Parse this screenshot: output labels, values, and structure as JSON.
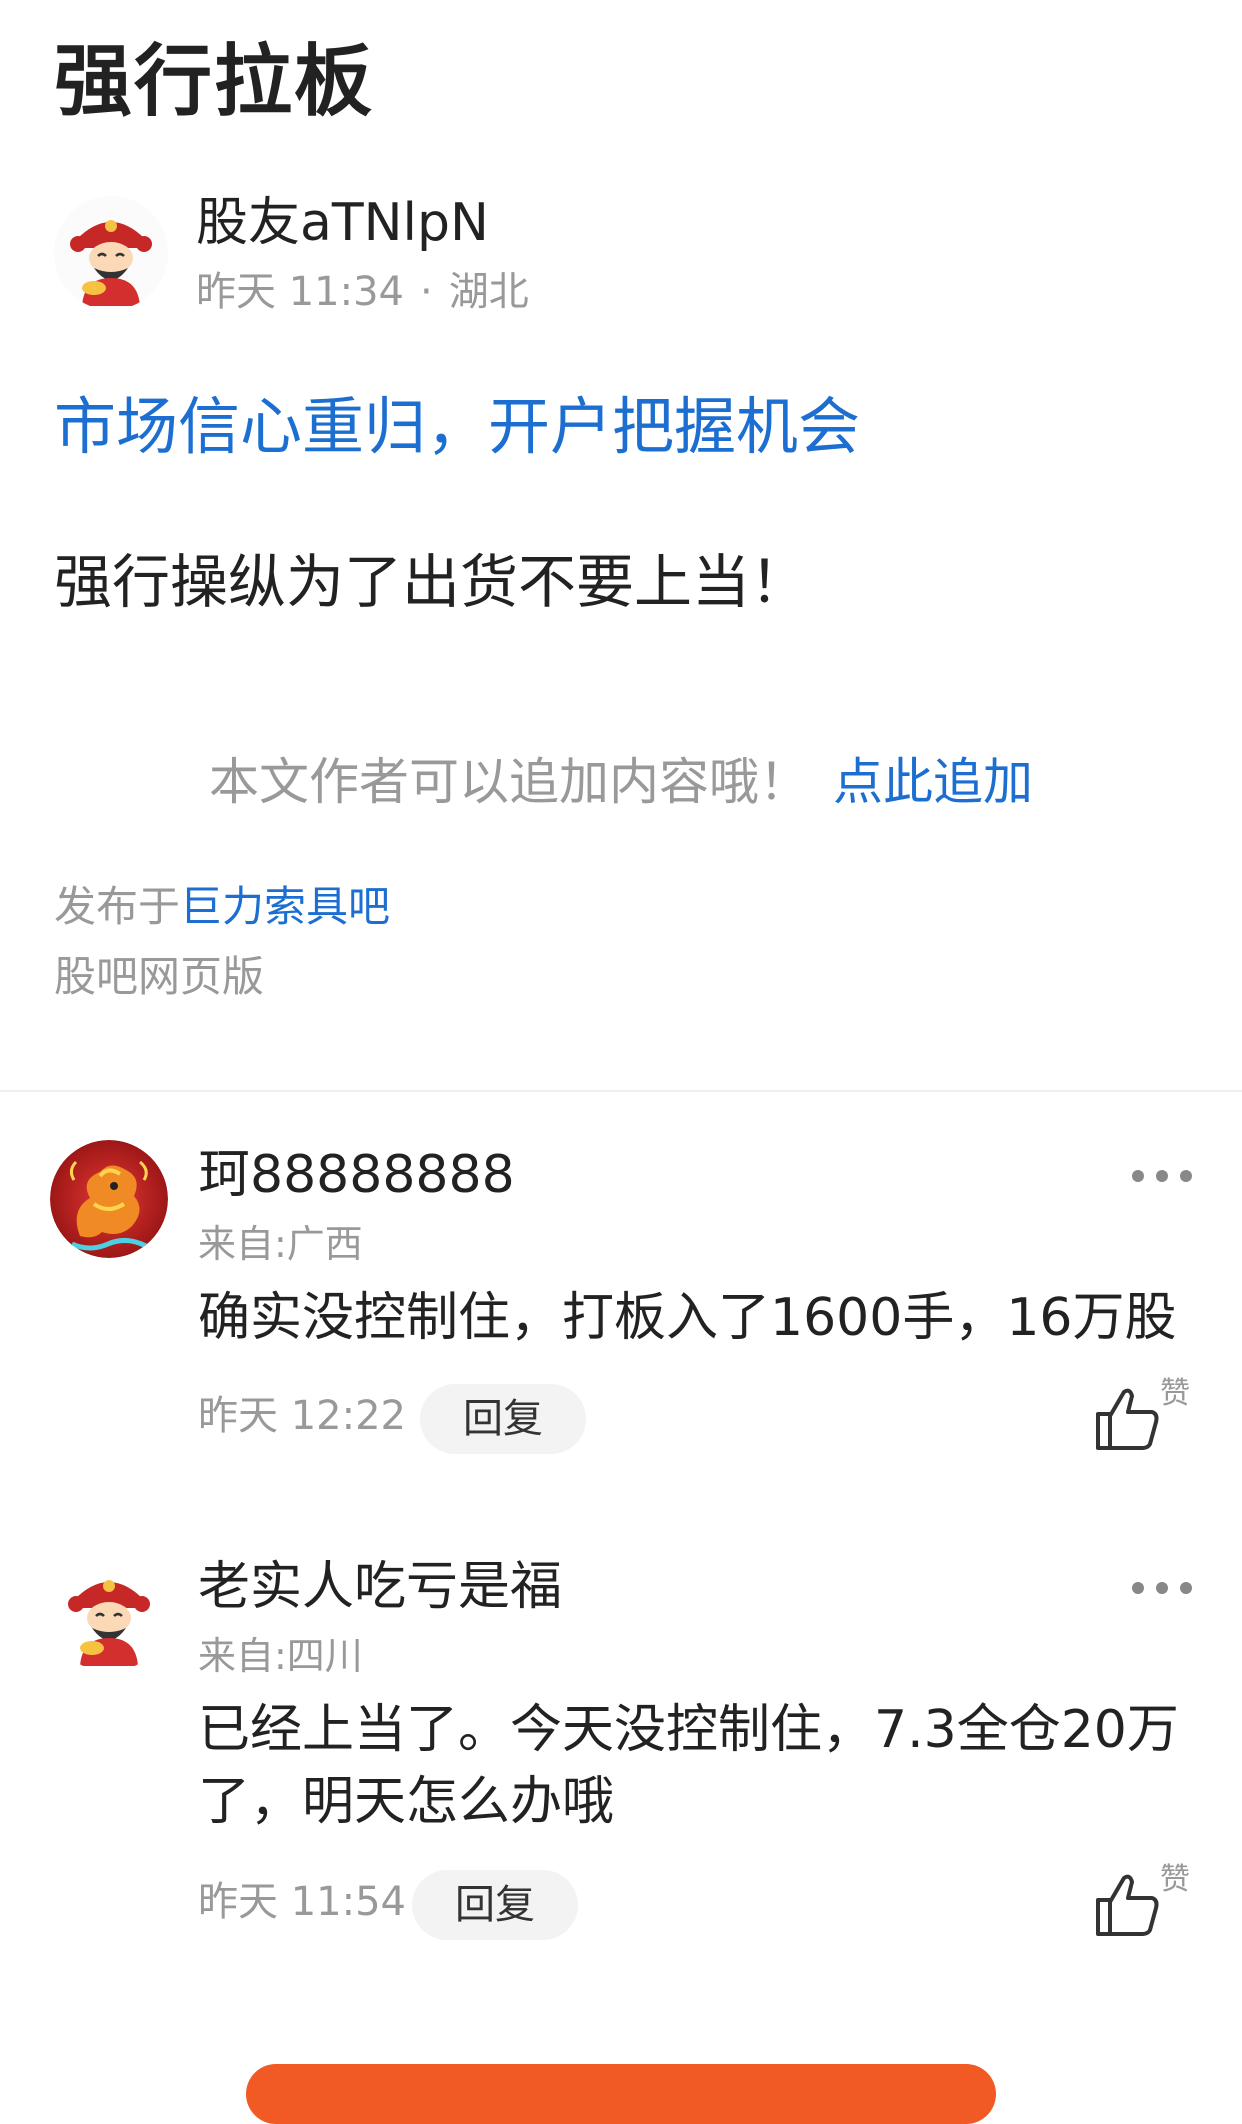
{
  "post": {
    "title": "强行拉板",
    "author": {
      "name": "股友aTNlpN",
      "time": "昨天 11:34",
      "separator": "·",
      "location": "湖北"
    },
    "promo_link": "市场信心重归，开户把握机会",
    "body": "强行操纵为了出货不要上当！",
    "append_note": {
      "text": "本文作者可以追加内容哦！",
      "link": "点此追加"
    },
    "published_prefix": "发布于",
    "forum": "巨力索具吧",
    "web_version": "股吧网页版"
  },
  "comments": [
    {
      "name": "珂88888888",
      "from": "来自:广西",
      "text": "确实没控制住，打板入了1600手，16万股",
      "time": "昨天 12:22",
      "reply_label": "回复",
      "like_label": "赞",
      "avatar": "dragon-avatar"
    },
    {
      "name": "老实人吃亏是福",
      "from": "来自:四川",
      "text": "已经上当了。今天没控制住，7.3全仓20万了，明天怎么办哦",
      "time": "昨天 11:54",
      "reply_label": "回复",
      "like_label": "赞",
      "avatar": "fortune-god-avatar"
    }
  ],
  "colors": {
    "link_blue": "#1c6fd1",
    "muted_gray": "#999999",
    "accent_orange": "#f15a24"
  }
}
